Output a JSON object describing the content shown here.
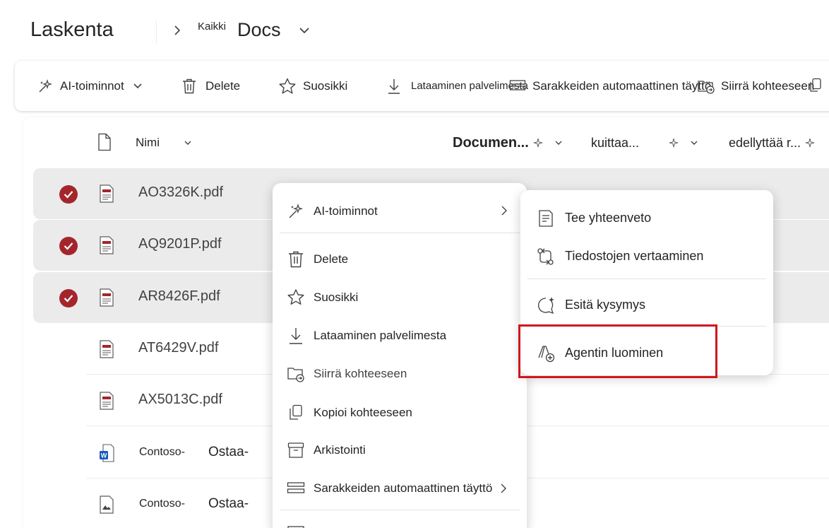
{
  "header": {
    "site_title": "Laskenta",
    "breadcrumb_small": "Kaikki",
    "breadcrumb_main": "Docs"
  },
  "toolbar": {
    "ai": "AI-toiminnot",
    "delete": "Delete",
    "favorite": "Suosikki",
    "download": "Lataaminen palvelimesta",
    "autofill": "Sarakkeiden automaattinen täyttö",
    "move": "Siirrä kohteeseen"
  },
  "columns": {
    "name": "Nimi",
    "document": "Documen...",
    "kuittaa": "kuittaa...",
    "edellyttaa": "edellyttää r..."
  },
  "files": [
    {
      "name": "AO3326K.pdf",
      "selected": true
    },
    {
      "name": "AQ9201P.pdf",
      "selected": true
    },
    {
      "name": "AR8426F.pdf",
      "selected": true
    },
    {
      "name": "AT6429V.pdf",
      "selected": false
    },
    {
      "name": "AX5013C.pdf",
      "selected": false
    },
    {
      "name": "Contoso-",
      "extra": "Ostaa-",
      "selected": false
    },
    {
      "name": "Contoso-",
      "extra": "Ostaa-",
      "selected": false
    }
  ],
  "context_menu": {
    "ai": "AI-toiminnot",
    "delete": "Delete",
    "favorite": "Suosikki",
    "download": "Lataaminen palvelimesta",
    "move": "Siirrä kohteeseen",
    "copy": "Kopioi kohteeseen",
    "archive": "Arkistointi",
    "autofill": "Sarakkeiden automaattinen täyttö"
  },
  "ai_submenu": {
    "summarize": "Tee yhteenveto",
    "compare": "Tiedostojen vertaaminen",
    "ask": "Esitä kysymys",
    "create_agent": "Agentin luominen"
  },
  "colors": {
    "accent_red": "#a4262c",
    "highlight": "#d0171d",
    "selected_row": "#ebebeb"
  }
}
